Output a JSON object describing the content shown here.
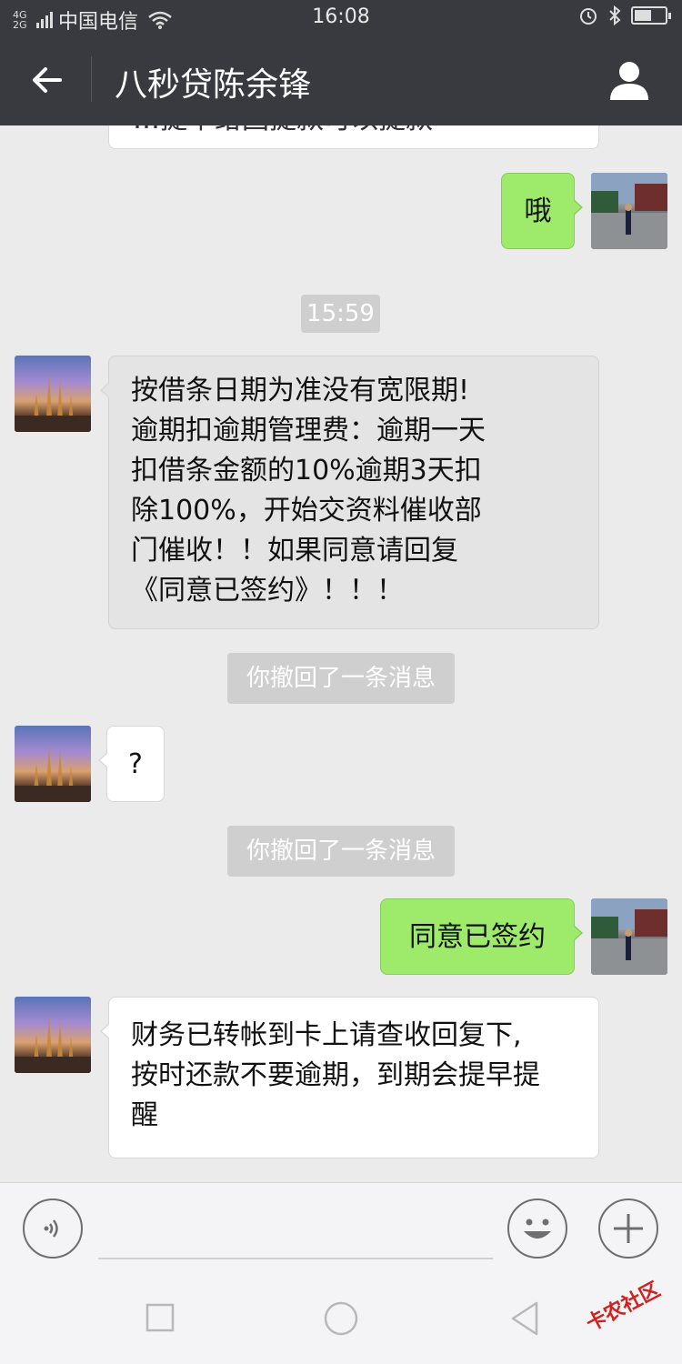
{
  "status": {
    "network": "4G 2G",
    "carrier": "中国电信",
    "time": "16:08",
    "battery_level": 0.55
  },
  "header": {
    "title": "八秒贷陈余锋"
  },
  "messages": [
    {
      "type": "partial-top",
      "text": "…提早给回提款可以提款"
    },
    {
      "type": "out",
      "text": "哦"
    },
    {
      "type": "time",
      "text": "15:59"
    },
    {
      "type": "in",
      "lines": [
        "按借条日期为准没有宽限期!",
        "逾期扣逾期管理费：逾期一天",
        "扣借条金额的10%逾期3天扣",
        "除100%，开始交资料催收部",
        "门催收！！如果同意请回复",
        "《同意已签约》！！！"
      ]
    },
    {
      "type": "system",
      "text": "你撤回了一条消息"
    },
    {
      "type": "in",
      "text": "?"
    },
    {
      "type": "system",
      "text": "你撤回了一条消息"
    },
    {
      "type": "out",
      "text": "同意已签约"
    },
    {
      "type": "in",
      "lines": [
        "财务已转帐到卡上请查收回复下,",
        "按时还款不要逾期，到期会提早提",
        "醒"
      ]
    }
  ],
  "watermark": "卡农社区",
  "colors": {
    "header_bg": "#393a3f",
    "chat_bg": "#ebebeb",
    "out_bubble": "#9eea6a",
    "in_bubble": "#ffffff"
  }
}
